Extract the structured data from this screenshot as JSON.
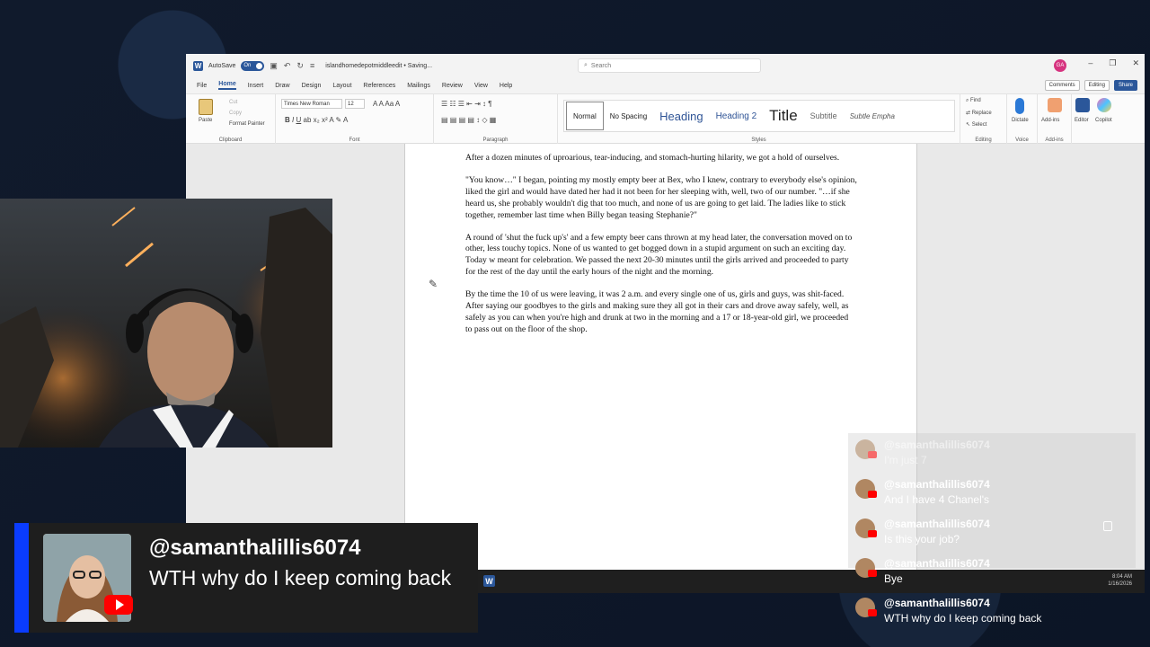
{
  "word": {
    "autosave_label": "AutoSave",
    "autosave_state": "On",
    "doc_title": "islandhomedepotmiddleedit • Saving...",
    "search_placeholder": "Search",
    "user_initials": "GA",
    "menu": [
      "File",
      "Home",
      "Insert",
      "Draw",
      "Design",
      "Layout",
      "References",
      "Mailings",
      "Review",
      "View",
      "Help"
    ],
    "active_menu": "Home",
    "comments_label": "Comments",
    "editing_label": "Editing",
    "share_label": "Share",
    "ribbon": {
      "paste": "Paste",
      "cut": "Cut",
      "copy": "Copy",
      "format_painter": "Format Painter",
      "clipboard": "Clipboard",
      "font_name": "Times New Roman",
      "font_size": "12",
      "font": "Font",
      "paragraph": "Paragraph",
      "styles_label": "Styles",
      "styles": [
        "Normal",
        "No Spacing",
        "Heading",
        "Heading 2",
        "Title",
        "Subtitle",
        "Subtle Empha"
      ],
      "find": "Find",
      "replace": "Replace",
      "select": "Select",
      "editing_group": "Editing",
      "dictate": "Dictate",
      "voice": "Voice",
      "addins": "Add-ins",
      "editor": "Editor",
      "copilot": "Copilot"
    },
    "paragraphs": [
      "After a dozen minutes of uproarious, tear-inducing, and stomach-hurting hilarity, we got a hold of ourselves.",
      "\"You know…\" I began, pointing my mostly empty beer at Bex, who I knew, contrary to everybody else's opinion, liked the girl and would have dated her had it not been for her sleeping with, well, two of our number. \"…if she heard us, she probably wouldn't dig that too much, and none of us are going to get laid. The ladies like to stick together, remember last time when Billy began teasing Stephanie?\"",
      "A round of 'shut the fuck up's' and a few empty beer cans thrown at my head later, the conversation moved on to other, less touchy topics. None of us wanted to get bogged down in a stupid argument on such an exciting day. Today w meant for celebration. We passed the next 20-30 minutes until the girls arrived and proceeded to party for the rest of the day until the early hours of the night and the morning.",
      "By the time the 10 of us were leaving, it was 2 a.m. and every single one of us, girls and guys, was shit-faced. After saying our goodbyes to the girls and making sure they all got in their cars and drove away safely, well, as safely as you can when you're high and drunk at two in the morning and a 17 or 18-year-old girl, we proceeded to pass out on the floor of the shop."
    ]
  },
  "taskbar": {
    "time": "8:04 AM",
    "date": "1/16/2026"
  },
  "banner": {
    "username": "@samanthalillis6074",
    "message": "WTH why do I keep coming back"
  },
  "chat": [
    {
      "name": "@samanthalillis6074",
      "text": "I'm just 7",
      "faded": true
    },
    {
      "name": "@samanthalillis6074",
      "text": "And I have 4 Chanel's",
      "faded": false
    },
    {
      "name": "@samanthalillis6074",
      "text": "Is this your job?",
      "faded": false
    },
    {
      "name": "@samanthalillis6074",
      "text": "Bye",
      "faded": false
    },
    {
      "name": "@samanthalillis6074",
      "text": "WTH why do I keep coming back",
      "faded": false
    }
  ],
  "colors": {
    "word_blue": "#2b579a",
    "banner_accent": "#0a3cff",
    "youtube_red": "#ff0000"
  }
}
